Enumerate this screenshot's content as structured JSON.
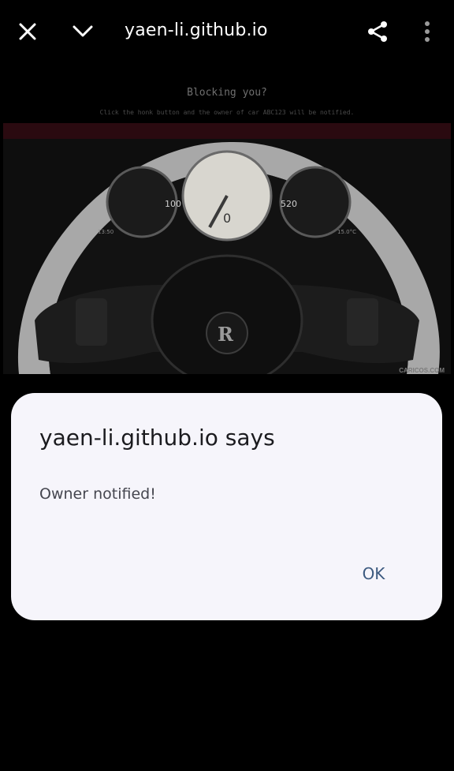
{
  "browser": {
    "title": "yaen-li.github.io",
    "icons": [
      "close-icon",
      "chevron-down-icon",
      "share-icon",
      "more-vert-icon"
    ]
  },
  "page": {
    "heading": "Blocking you?",
    "subtext": "Click the honk button and the owner of car ABC123 will be notified.",
    "watermark": "CARICOS.COM",
    "dashboard": {
      "speed_left": "100",
      "speed_right": "520",
      "center_value": "0",
      "left_bottom": "13:50",
      "right_bottom": "15.0°C"
    }
  },
  "dialog": {
    "title": "yaen-li.github.io says",
    "message": "Owner notified!",
    "ok_label": "OK"
  },
  "colors": {
    "dialog_bg": "#f6f5fb",
    "ok_color": "#3d5a80",
    "overlay": "#000000"
  }
}
